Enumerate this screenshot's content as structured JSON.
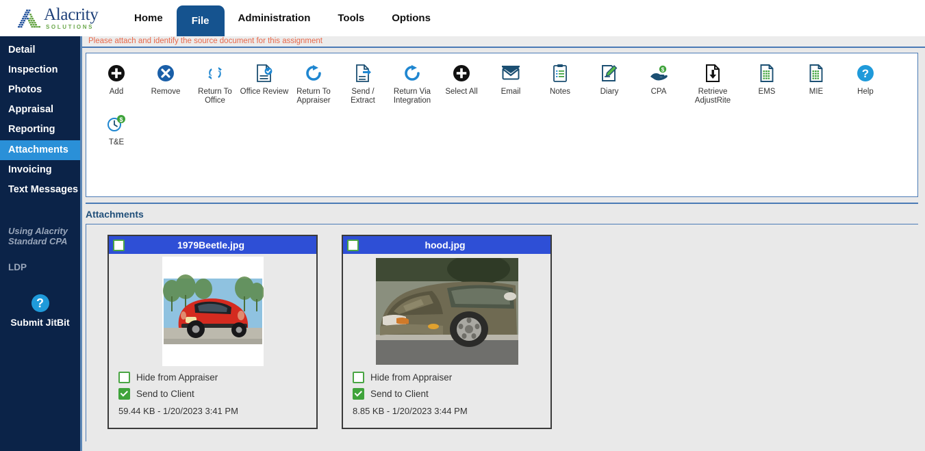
{
  "brand": {
    "name": "Alacrity",
    "tagline": "SOLUTIONS",
    "logo_icon": "alacrity-a-mosaic-logo",
    "colors": {
      "word": "#1d3f78",
      "tagline": "#6aa74a",
      "accent": "#15538f"
    }
  },
  "nav": {
    "tabs": [
      {
        "label": "Home",
        "active": false
      },
      {
        "label": "File",
        "active": true
      },
      {
        "label": "Administration",
        "active": false
      },
      {
        "label": "Tools",
        "active": false
      },
      {
        "label": "Options",
        "active": false
      }
    ]
  },
  "sidebar": {
    "items": [
      {
        "label": "Detail",
        "active": false
      },
      {
        "label": "Inspection",
        "active": false
      },
      {
        "label": "Photos",
        "active": false
      },
      {
        "label": "Appraisal",
        "active": false
      },
      {
        "label": "Reporting",
        "active": false
      },
      {
        "label": "Attachments",
        "active": true
      },
      {
        "label": "Invoicing",
        "active": false
      },
      {
        "label": "Text Messages",
        "active": false
      }
    ],
    "note": "Using Alacrity Standard CPA",
    "plain": "LDP",
    "help_icon": "question-mark-icon",
    "help_glyph": "?",
    "submit_label": "Submit JitBit",
    "active_color": "#2a90d8",
    "bg_color": "#0b2348"
  },
  "alert": {
    "message": "Please attach and identify the source document for this assignment",
    "color": "#e8684a"
  },
  "toolbar": {
    "row1": [
      {
        "label": "Add",
        "icon": "plus-circle-black-icon"
      },
      {
        "label": "Remove",
        "icon": "x-circle-blue-icon"
      },
      {
        "label": "Return To\nOffice",
        "icon": "refresh-two-arrows-icon"
      },
      {
        "label": "Office Review",
        "icon": "document-check-icon"
      },
      {
        "label": "Return To\nAppraiser",
        "icon": "circular-arrow-icon"
      },
      {
        "label": "Send / Extract",
        "icon": "document-export-icon"
      },
      {
        "label": "Return Via\nIntegration",
        "icon": "circular-arrow-icon"
      },
      {
        "label": "Select All",
        "icon": "plus-circle-black-icon"
      },
      {
        "label": "Email",
        "icon": "envelope-icon"
      },
      {
        "label": "Notes",
        "icon": "clipboard-notes-icon"
      },
      {
        "label": "Diary",
        "icon": "pencil-document-icon"
      },
      {
        "label": "CPA",
        "icon": "hand-coin-icon"
      },
      {
        "label": "Retrieve\nAdjustRite",
        "icon": "document-download-icon"
      },
      {
        "label": "EMS",
        "icon": "green-grid-document-icon"
      },
      {
        "label": "MIE",
        "icon": "green-grid-document-icon"
      },
      {
        "label": "Help",
        "icon": "question-circle-icon"
      }
    ],
    "row2": [
      {
        "label": "T&E",
        "icon": "clock-dollar-icon"
      }
    ]
  },
  "attachments": {
    "section_title": "Attachments",
    "cards": [
      {
        "filename": "1979Beetle.jpg",
        "selected": false,
        "image": "red-vw-beetle-rear-photo",
        "hide_label": "Hide from Appraiser",
        "hide_checked": false,
        "send_label": "Send to Client",
        "send_checked": true,
        "meta": "59.44 KB - 1/20/2023 3:41 PM"
      },
      {
        "filename": "hood.jpg",
        "selected": false,
        "image": "damaged-sedan-hood-photo",
        "hide_label": "Hide from Appraiser",
        "hide_checked": false,
        "send_label": "Send to Client",
        "send_checked": true,
        "meta": "8.85 KB - 1/20/2023 3:44 PM"
      }
    ]
  }
}
